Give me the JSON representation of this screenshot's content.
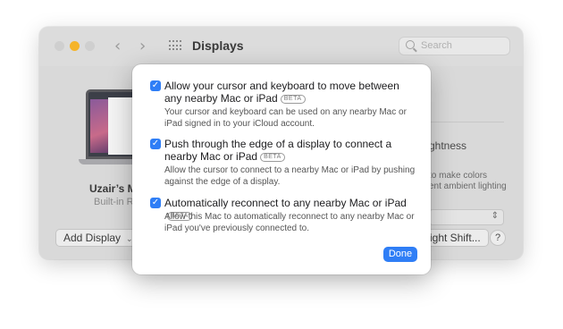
{
  "window": {
    "title": "Displays",
    "search_placeholder": "Search",
    "device_name": "Uzair’s M",
    "device_subtitle": "Built-in R",
    "add_display_label": "Add Display",
    "right_heading": "ghtness",
    "right_desc_1": "to make colors",
    "right_desc_2": "ent ambient lighting",
    "night_shift_label": "ight Shift...",
    "help_label": "?"
  },
  "dialog": {
    "options": [
      {
        "checked": true,
        "title": "Allow your cursor and keyboard to move between any nearby Mac or iPad",
        "badge": "BETA",
        "description": "Your cursor and keyboard can be used on any nearby Mac or iPad signed in to your iCloud account."
      },
      {
        "checked": true,
        "title": "Push through the edge of a display to connect a nearby Mac or iPad",
        "badge": "BETA",
        "description": "Allow the cursor to connect to a nearby Mac or iPad by pushing against the edge of a display."
      },
      {
        "checked": true,
        "title": "Automatically reconnect to any nearby Mac or iPad",
        "badge": "BETA",
        "description": "Allow this Mac to automatically reconnect to any nearby Mac or iPad you've previously connected to."
      }
    ],
    "done_label": "Done"
  },
  "icons": {
    "checkmark": "✓",
    "back": "‹",
    "forward": "›",
    "chevron_down": "⌄",
    "updown": "⇕"
  },
  "colors": {
    "accent": "#2f7ef6",
    "minimize_light": "#f5b42a"
  }
}
